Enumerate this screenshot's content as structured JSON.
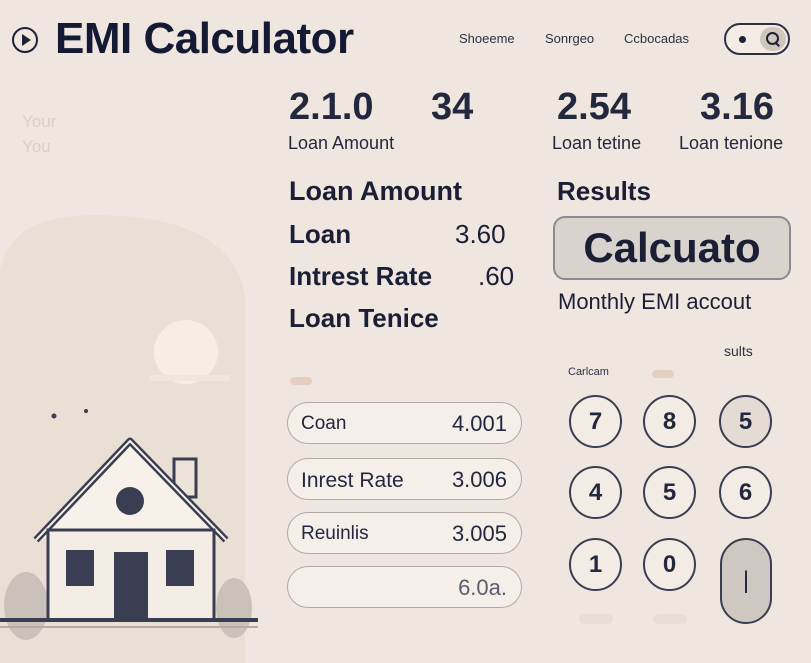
{
  "header": {
    "title": "EMI Calculator",
    "nav": [
      "Shoeeme",
      "Sonrgeo",
      "Ccbocadas"
    ],
    "icons": [
      "play-icon",
      "search-icon"
    ]
  },
  "ghost_text": [
    "Your",
    "You"
  ],
  "stats": [
    {
      "value": "2.1.0",
      "label": "Loan Amount"
    },
    {
      "value": "34",
      "label": ""
    },
    {
      "value": "2.54",
      "label": "Loan tetine"
    },
    {
      "value": "3.16",
      "label": "Loan tenione"
    }
  ],
  "form": {
    "heading": "Loan Amount",
    "rows": [
      {
        "label": "Loan",
        "value": "3.60"
      },
      {
        "label": "Intrest Rate",
        "value": ".60"
      },
      {
        "label": "Loan Tenice",
        "value": ""
      }
    ]
  },
  "results": {
    "heading": "Results",
    "button_label": "Calcuato",
    "monthly_label": "Monthly EMI accout",
    "sults_label": "sults",
    "calculator_label": "Carlcam"
  },
  "inputs": [
    {
      "label": "Coan",
      "value": "4.001"
    },
    {
      "label": "Inrest Rate",
      "value": "3.006"
    },
    {
      "label": "Reuinlis",
      "value": "3.005"
    },
    {
      "label": "",
      "value": "6.0a."
    }
  ],
  "keypad": [
    "7",
    "8",
    "5",
    "4",
    "5",
    "6",
    "1",
    "0",
    "|"
  ],
  "colors": {
    "background": "#efe7df",
    "text": "#1c2138",
    "button": "#d9d3cd",
    "accent_sun": "#f6e8dc"
  }
}
